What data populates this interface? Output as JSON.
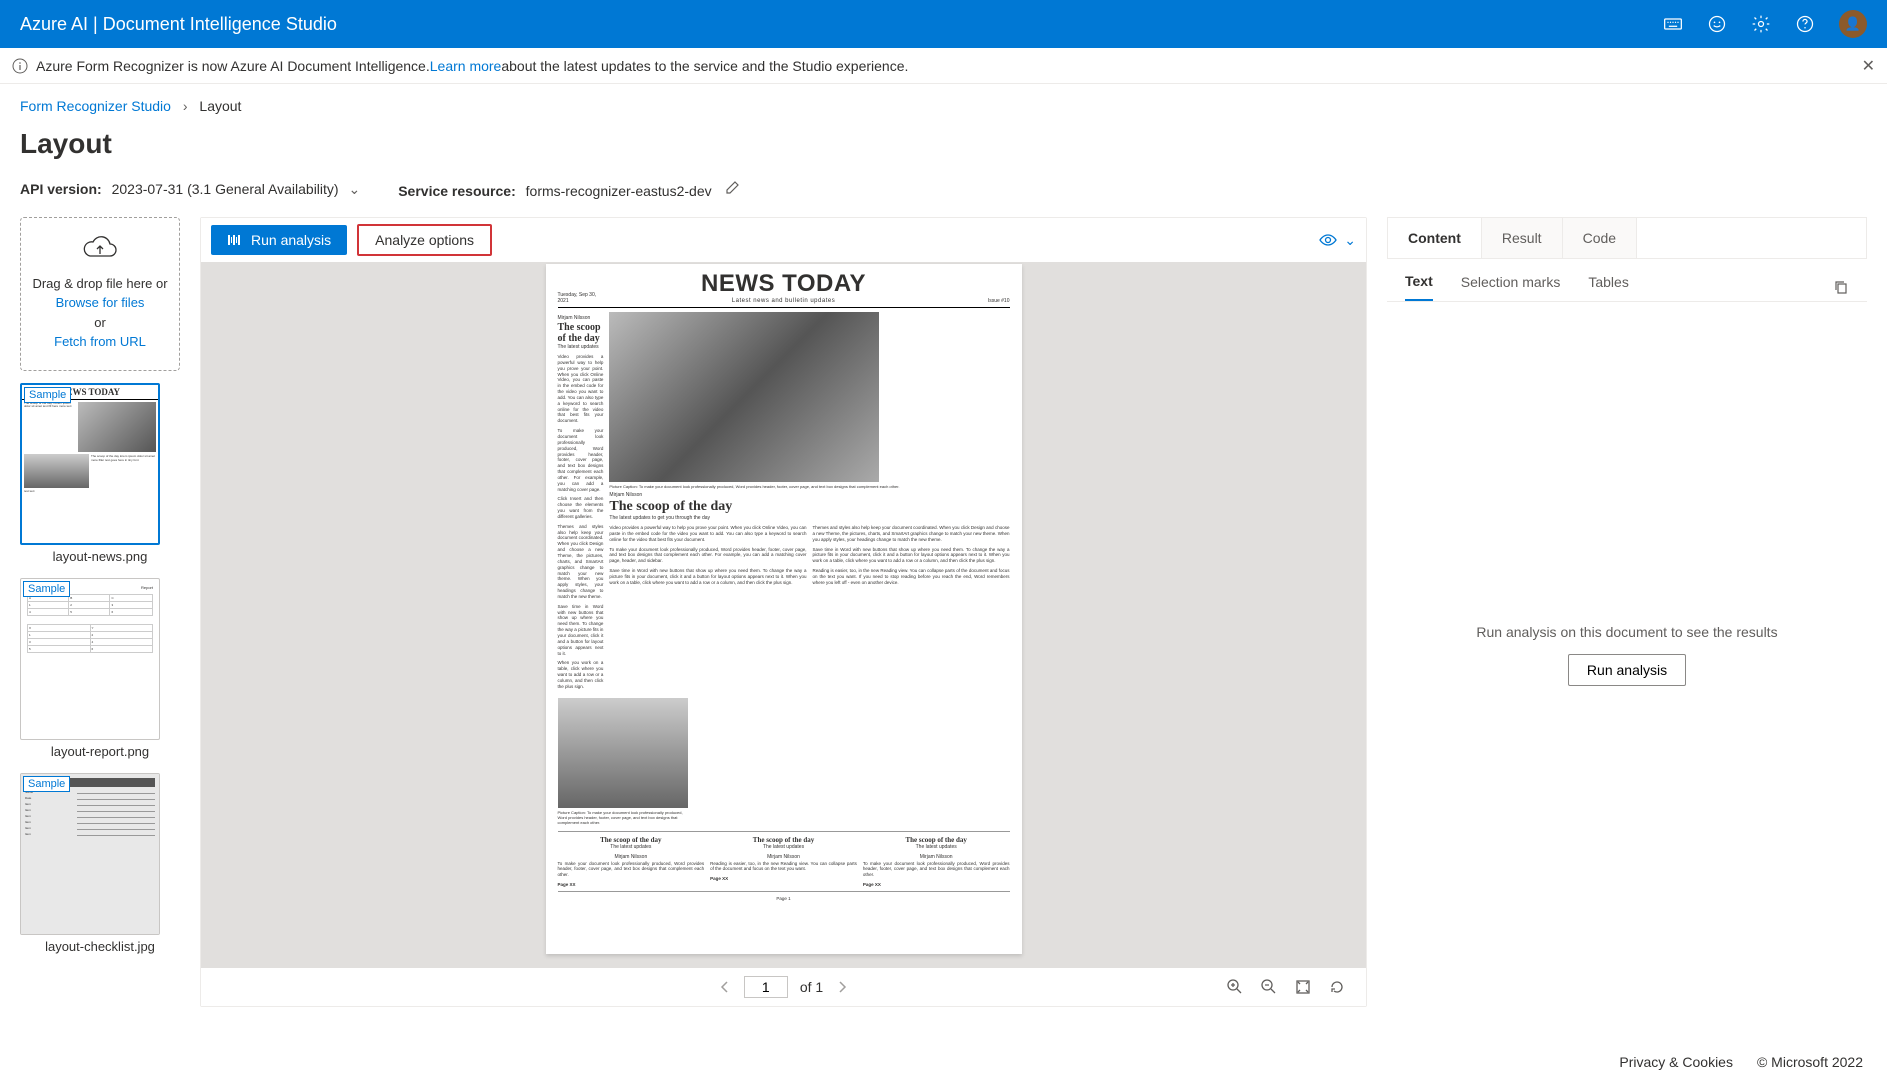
{
  "header": {
    "title": "Azure AI | Document Intelligence Studio"
  },
  "info_bar": {
    "prefix": "Azure Form Recognizer is now Azure AI Document Intelligence. ",
    "link": "Learn more",
    "suffix": " about the latest updates to the service and the Studio experience."
  },
  "breadcrumb": {
    "root": "Form Recognizer Studio",
    "current": "Layout"
  },
  "page_title": "Layout",
  "settings": {
    "api_label": "API version:",
    "api_value": "2023-07-31 (3.1 General Availability)",
    "resource_label": "Service resource:",
    "resource_value": "forms-recognizer-eastus2-dev"
  },
  "dropzone": {
    "line1": "Drag & drop file here or",
    "browse": "Browse for files",
    "or": "or",
    "fetch": "Fetch from URL"
  },
  "thumbs": [
    {
      "badge": "Sample",
      "label": "layout-news.png",
      "selected": true
    },
    {
      "badge": "Sample",
      "label": "layout-report.png",
      "selected": false
    },
    {
      "badge": "Sample",
      "label": "layout-checklist.jpg",
      "selected": false
    }
  ],
  "toolbar": {
    "run": "Run analysis",
    "options": "Analyze options"
  },
  "pager": {
    "current": "1",
    "of": "of 1"
  },
  "right": {
    "tabs1": [
      "Content",
      "Result",
      "Code"
    ],
    "tabs2": [
      "Text",
      "Selection marks",
      "Tables"
    ],
    "empty_msg": "Run analysis on this document to see the results",
    "empty_btn": "Run analysis"
  },
  "footer": {
    "privacy": "Privacy & Cookies",
    "copyright": "© Microsoft 2022"
  },
  "doc": {
    "date": "Tuesday, Sep 30, 2021",
    "title": "NEWS TODAY",
    "subtitle": "Latest news and bulletin updates",
    "issue": "Issue #10",
    "byline": "Mirjam Nilsson",
    "scoop": "The scoop of the day",
    "latest": "The latest updates",
    "latest2": "The latest updates to get you through the day",
    "page_xx": "Page XX",
    "page_1": "Page 1"
  }
}
